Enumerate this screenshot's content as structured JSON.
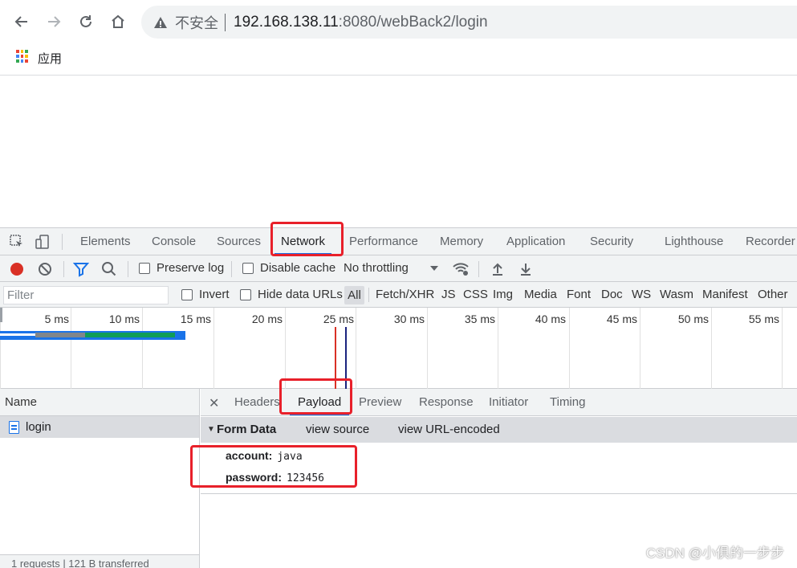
{
  "browser": {
    "security_label": "不安全",
    "url_host": "192.168.138.11",
    "url_rest": ":8080/webBack2/login",
    "bookmarks_label": "应用",
    "apps_colors": [
      "#ea4335",
      "#fbbc04",
      "#34a853",
      "#4285f4",
      "#ea4335",
      "#fbbc04",
      "#34a853",
      "#4285f4",
      "#ea4335"
    ]
  },
  "devtools": {
    "tabs": [
      "Elements",
      "Console",
      "Sources",
      "Network",
      "Performance",
      "Memory",
      "Application",
      "Security",
      "Lighthouse",
      "Recorder"
    ],
    "active_tab": "Network",
    "toolbar": {
      "preserve_log": "Preserve log",
      "disable_cache": "Disable cache",
      "throttling": "No throttling"
    },
    "filter": {
      "placeholder": "Filter",
      "invert": "Invert",
      "hide_data_urls": "Hide data URLs",
      "types": [
        "All",
        "Fetch/XHR",
        "JS",
        "CSS",
        "Img",
        "Media",
        "Font",
        "Doc",
        "WS",
        "Wasm",
        "Manifest",
        "Other"
      ]
    },
    "timeline_ticks": [
      "5 ms",
      "10 ms",
      "15 ms",
      "20 ms",
      "25 ms",
      "30 ms",
      "35 ms",
      "40 ms",
      "45 ms",
      "50 ms",
      "55 ms"
    ],
    "name_header": "Name",
    "requests": [
      {
        "name": "login"
      }
    ],
    "status_text": "1 requests  |  121 B transferred",
    "detail_tabs": [
      "Headers",
      "Payload",
      "Preview",
      "Response",
      "Initiator",
      "Timing"
    ],
    "active_detail_tab": "Payload",
    "form_data": {
      "title": "Form Data",
      "view_source": "view source",
      "view_url_encoded": "view URL-encoded",
      "fields": [
        {
          "key": "account:",
          "value": "java"
        },
        {
          "key": "password:",
          "value": "123456"
        }
      ]
    }
  },
  "watermark": "CSDN @小俱的一步步",
  "colors": {
    "accent": "#1a73e8",
    "record_red": "#d93025",
    "highlight_red": "#e8202a"
  }
}
